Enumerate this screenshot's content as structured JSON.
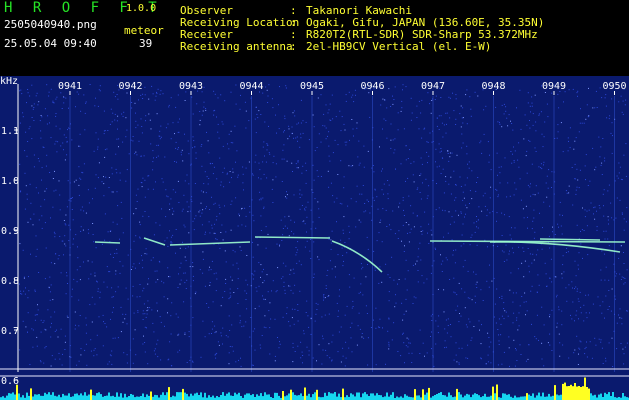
{
  "header": {
    "app_title": "H R O F F T",
    "version": "1.0.0",
    "file_name": "2505040940.png",
    "date_time": "25.05.04 09:40",
    "mode_label": "meteor",
    "meteor_count": "39",
    "info": [
      {
        "label": "Observer",
        "sep": ":",
        "value": "Takanori Kawachi"
      },
      {
        "label": "Receiving Location",
        "sep": ":",
        "value": "Ogaki, Gifu, JAPAN (136.60E, 35.35N)"
      },
      {
        "label": "Receiver",
        "sep": ":",
        "value": "R820T2(RTL-SDR) SDR-Sharp 53.372MHz"
      },
      {
        "label": "Receiving antenna",
        "sep": ":",
        "value": "2el-HB9CV Vertical (el. E-W)"
      }
    ]
  },
  "spectrogram": {
    "unit_label": "kHz",
    "y_ticks": [
      "1.1",
      "1.0",
      "0.9",
      "0.8",
      "0.7",
      "0.6"
    ],
    "time_ticks": [
      "0941",
      "0942",
      "0943",
      "0944",
      "0945",
      "0946",
      "0947",
      "0948",
      "0949",
      "0950"
    ],
    "colors": {
      "background": "#0a1a6e",
      "noise": "#2c48d8",
      "axis_text": "#ffffff",
      "echo": "#9fffd0",
      "power_bar": "#16d6f0",
      "power_peak": "#ffff22"
    }
  }
}
